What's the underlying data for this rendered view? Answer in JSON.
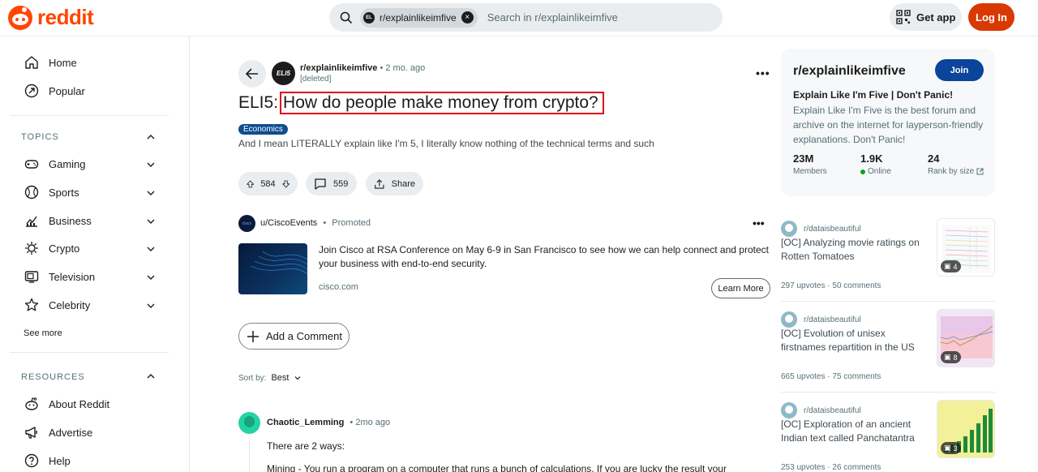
{
  "header": {
    "logo_text": "reddit",
    "search_chip": "r/explainlikeimfive",
    "search_placeholder": "Search in r/explainlikeimfive",
    "get_app": "Get app",
    "login": "Log In"
  },
  "sidebar": {
    "primary": [
      {
        "label": "Home",
        "icon": "home-icon"
      },
      {
        "label": "Popular",
        "icon": "popular-icon"
      }
    ],
    "topics_title": "TOPICS",
    "topics": [
      {
        "label": "Gaming",
        "icon": "gamepad-icon"
      },
      {
        "label": "Sports",
        "icon": "sports-icon"
      },
      {
        "label": "Business",
        "icon": "chart-icon"
      },
      {
        "label": "Crypto",
        "icon": "crypto-icon"
      },
      {
        "label": "Television",
        "icon": "tv-icon"
      },
      {
        "label": "Celebrity",
        "icon": "star-icon"
      }
    ],
    "see_more": "See more",
    "resources_title": "RESOURCES",
    "resources": [
      {
        "label": "About Reddit",
        "icon": "reddit-icon"
      },
      {
        "label": "Advertise",
        "icon": "megaphone-icon"
      },
      {
        "label": "Help",
        "icon": "help-icon"
      }
    ]
  },
  "post": {
    "subreddit": "r/explainlikeimfive",
    "avatar_text": "ELI5",
    "time": "• 2 mo. ago",
    "author": "[deleted]",
    "title_prefix": "ELI5:",
    "title_main": "How do people make money from crypto?",
    "flair": "Economics",
    "body": "And I mean LITERALLY explain like I'm 5, I literally know nothing of the technical terms and such",
    "upvotes": "584",
    "comments": "559",
    "share": "Share"
  },
  "promoted": {
    "user": "u/CiscoEvents",
    "label": "Promoted",
    "text": "Join Cisco at RSA Conference on May 6-9 in San Francisco to see how we can help connect and protect your business with end-to-end security.",
    "domain": "cisco.com",
    "cta": "Learn More"
  },
  "comments_section": {
    "add_comment": "Add a Comment",
    "sort_label": "Sort by:",
    "sort_value": "Best",
    "first_comment": {
      "user": "Chaotic_Lemming",
      "time": "• 2mo ago",
      "line1": "There are 2 ways:",
      "line2": "Mining - You run a program on a computer that runs a bunch of calculations. If you are lucky the result your"
    }
  },
  "community": {
    "name": "r/explainlikeimfive",
    "join": "Join",
    "tagline": "Explain Like I'm Five | Don't Panic!",
    "description": "Explain Like I'm Five is the best forum and archive on the internet for layperson-friendly explanations. Don't Panic!",
    "members": "23M",
    "members_label": "Members",
    "online": "1.9K",
    "online_label": "Online",
    "rank": "24",
    "rank_label": "Rank by size"
  },
  "related": [
    {
      "sub": "r/dataisbeautiful",
      "title": "[OC] Analyzing movie ratings on Rotten Tomatoes",
      "upvotes": "297 upvotes",
      "comments": "50 comments",
      "images": "4"
    },
    {
      "sub": "r/dataisbeautiful",
      "title": "[OC] Evolution of unisex firstnames repartition in the US",
      "upvotes": "665 upvotes",
      "comments": "75 comments",
      "images": "8"
    },
    {
      "sub": "r/dataisbeautiful",
      "title": "[OC] Exploration of an ancient Indian text called Panchatantra",
      "upvotes": "253 upvotes",
      "comments": "26 comments",
      "images": "3"
    }
  ],
  "colors": {
    "brand": "#ff4500",
    "login": "#d93900",
    "join": "#0a449b",
    "flair": "#0e4d8f",
    "highlight_box": "#e0001b"
  }
}
